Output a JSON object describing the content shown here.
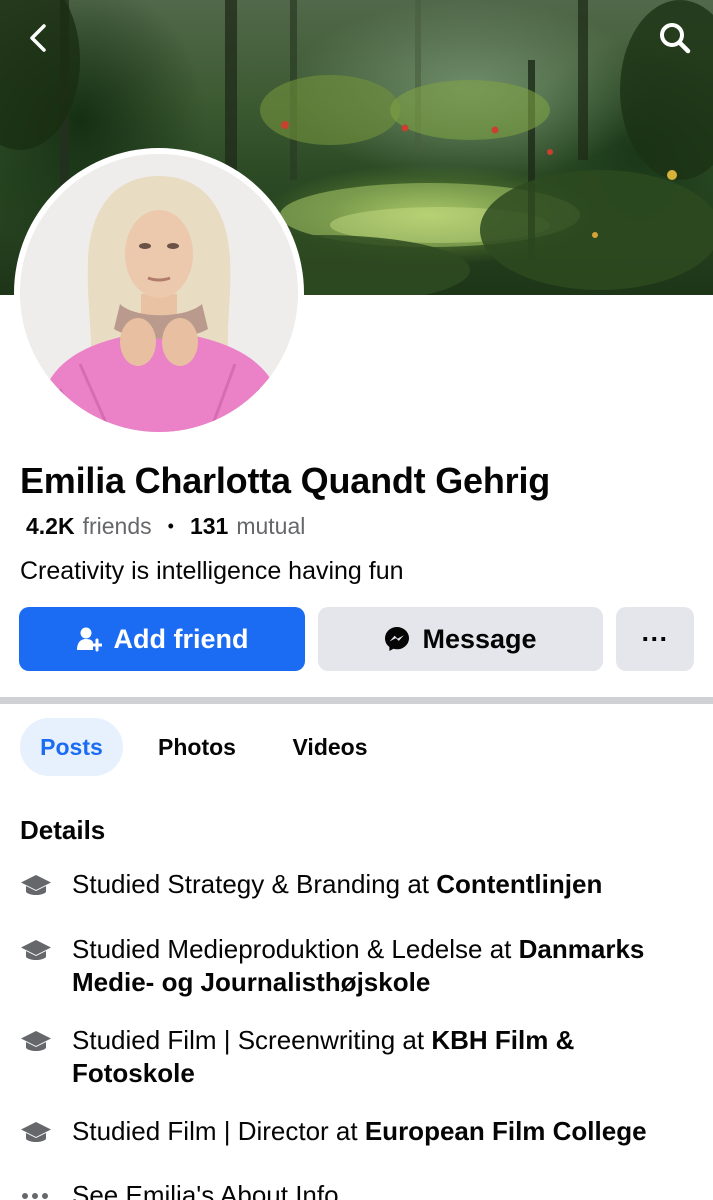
{
  "header": {
    "back_icon": "back-chevron-icon",
    "search_icon": "search-icon"
  },
  "profile": {
    "name": "Emilia Charlotta Quandt Gehrig",
    "friends_count": "4.2K",
    "friends_label": "friends",
    "mutual_count": "131",
    "mutual_label": "mutual",
    "bio": "Creativity is intelligence having fun"
  },
  "actions": {
    "add_friend": "Add friend",
    "message": "Message",
    "more": "···"
  },
  "tabs": [
    {
      "label": "Posts",
      "active": true
    },
    {
      "label": "Photos",
      "active": false
    },
    {
      "label": "Videos",
      "active": false
    }
  ],
  "details": {
    "title": "Details",
    "items": [
      {
        "prefix": "Studied Strategy & Branding at ",
        "place": "Contentlinjen"
      },
      {
        "prefix": "Studied Medieproduktion & Ledelse at ",
        "place": "Danmarks Medie- og Journalisthøjskole"
      },
      {
        "prefix": "Studied Film | Screenwriting at ",
        "place": "KBH Film & Fotoskole"
      },
      {
        "prefix": "Studied Film | Director at ",
        "place": "European Film College"
      }
    ],
    "see_about": "See Emilia's About Info"
  },
  "colors": {
    "accent": "#1b6cf2",
    "secondary_button": "#e4e6eb",
    "active_tab_bg": "#e7f0fd",
    "muted_text": "#65676b"
  }
}
